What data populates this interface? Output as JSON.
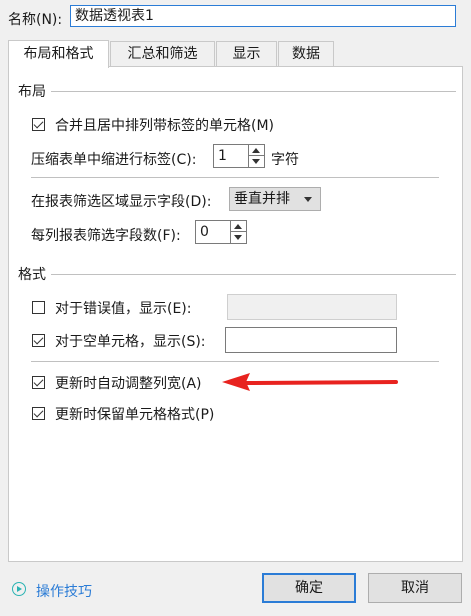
{
  "header": {
    "name_label": "名称(N):",
    "name_value": "数据透视表1"
  },
  "tabs": [
    {
      "label": "布局和格式",
      "active": true
    },
    {
      "label": "汇总和筛选",
      "active": false
    },
    {
      "label": "显示",
      "active": false
    },
    {
      "label": "数据",
      "active": false
    }
  ],
  "layout_section": {
    "title": "布局",
    "merge_center": {
      "label": "合并且居中排列带标签的单元格(M)",
      "checked": true
    },
    "indent": {
      "label": "压缩表单中缩进行标签(C):",
      "value": "1",
      "unit": "字符"
    },
    "filter_area": {
      "label": "在报表筛选区域显示字段(D):",
      "value": "垂直并排"
    },
    "filter_count": {
      "label": "每列报表筛选字段数(F):",
      "value": "0"
    }
  },
  "format_section": {
    "title": "格式",
    "error_values": {
      "label": "对于错误值，显示(E):",
      "checked": false,
      "value": ""
    },
    "empty_cells": {
      "label": "对于空单元格，显示(S):",
      "checked": true,
      "value": ""
    },
    "autofit_width": {
      "label": "更新时自动调整列宽(A)",
      "checked": true
    },
    "preserve_format": {
      "label": "更新时保留单元格格式(P)",
      "checked": true
    }
  },
  "annotation": {
    "color": "#e8231f"
  },
  "footer": {
    "tips_label": "操作技巧",
    "ok_label": "确定",
    "cancel_label": "取消"
  },
  "colors": {
    "accent": "#2b7cd6",
    "tips_icon": "#2bb3b3"
  }
}
